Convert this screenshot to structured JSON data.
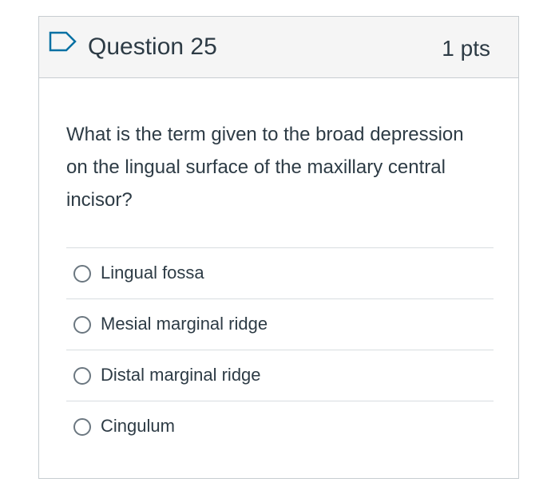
{
  "question": {
    "title": "Question 25",
    "points": "1 pts",
    "flag_icon": "flag-outline-icon",
    "text": "What is the term given to the broad depression on the lingual surface of the maxillary central incisor?"
  },
  "answers": [
    {
      "label": "Lingual fossa",
      "selected": false
    },
    {
      "label": "Mesial marginal ridge",
      "selected": false
    },
    {
      "label": "Distal marginal ridge",
      "selected": false
    },
    {
      "label": "Cingulum",
      "selected": false
    }
  ],
  "colors": {
    "text": "#2d3b45",
    "header_bg": "#f5f5f5",
    "border": "#c7cdd1",
    "flag": "#0770a3"
  }
}
